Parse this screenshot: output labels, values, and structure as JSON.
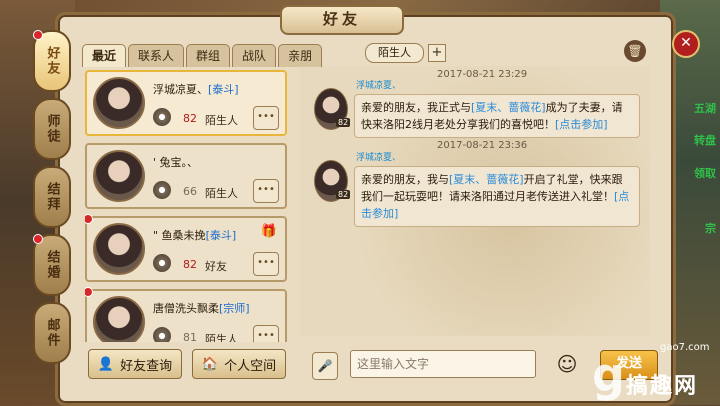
{
  "window": {
    "title": "好友"
  },
  "vnav": [
    {
      "label": "好友",
      "active": true
    },
    {
      "label": "师徒"
    },
    {
      "label": "结拜"
    },
    {
      "label": "结婚"
    },
    {
      "label": "邮件"
    }
  ],
  "tabs": [
    "最近",
    "联系人",
    "群组",
    "战队",
    "亲朋"
  ],
  "friends": [
    {
      "name": "浮城凉夏、",
      "tag": "[泰斗]",
      "level": "82",
      "relation": "陌生人",
      "selected": true
    },
    {
      "name": "' 兔宝。、",
      "tag": "",
      "level": "66",
      "relation": "陌生人"
    },
    {
      "name": "\" 鱼桑未挽",
      "tag": "[泰斗]",
      "level": "82",
      "relation": "好友"
    },
    {
      "name": "唐僧洗头飘柔",
      "tag": "[宗师]",
      "level": "81",
      "relation": "陌生人"
    }
  ],
  "more_label": "•••",
  "buttons": {
    "search": "好友查询",
    "space": "个人空间",
    "send": "发送"
  },
  "chat_header": {
    "target": "陌生人",
    "plus": "+"
  },
  "messages": [
    {
      "time": "2017-08-21 23:29",
      "sender": "浮城凉夏、",
      "level": "82",
      "pre": "亲爱的朋友，我正式与",
      "hl": "[夏末、蔷薇花]",
      "mid": "成为了夫妻，请快来洛阳2线月老处分享我们的喜悦吧！",
      "link": "[点击参加]"
    },
    {
      "time": "2017-08-21 23:36",
      "sender": "浮城凉夏、",
      "level": "82",
      "pre": "亲爱的朋友，我与",
      "hl": "[夏末、蔷薇花]",
      "mid": "开启了礼堂，快来跟我们一起玩耍吧！请来洛阳通过月老传送进入礼堂！",
      "link": "[点击参加]"
    }
  ],
  "input": {
    "placeholder": "这里输入文字"
  },
  "right_edge_text": [
    "五湖",
    "转盘",
    "领取",
    "宗"
  ],
  "watermark": {
    "site": "gao7.com",
    "name": "搞趣网",
    "logo": "g"
  }
}
